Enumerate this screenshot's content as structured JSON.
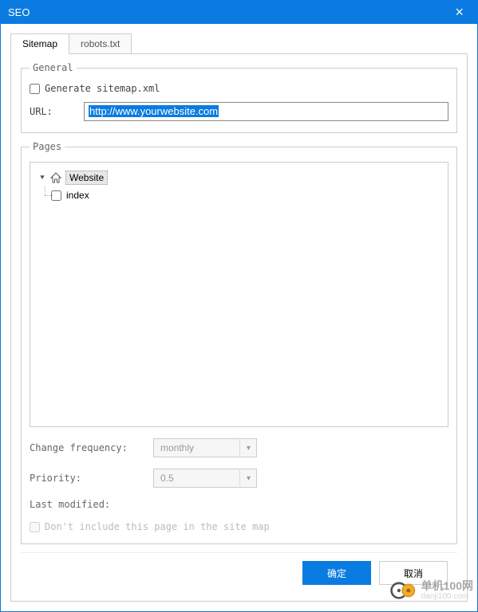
{
  "window": {
    "title": "SEO"
  },
  "tabs": {
    "sitemap": "Sitemap",
    "robots": "robots.txt"
  },
  "general": {
    "legend": "General",
    "generate_label": "Generate sitemap.xml",
    "generate_checked": false,
    "url_label": "URL:",
    "url_value": "http://www.yourwebsite.com"
  },
  "pages": {
    "legend": "Pages",
    "tree": {
      "root": {
        "label": "Website",
        "expanded": true
      },
      "children": [
        {
          "label": "index",
          "checked": false
        }
      ]
    },
    "change_freq_label": "Change frequency:",
    "change_freq_value": "monthly",
    "priority_label": "Priority:",
    "priority_value": "0.5",
    "last_modified_label": "Last modified:",
    "last_modified_value": "",
    "exclude_label": "Don't include this page in the site map",
    "exclude_checked": false
  },
  "buttons": {
    "ok": "确定",
    "cancel": "取消"
  },
  "watermark": {
    "brand": "单机100网",
    "domain": "danji100.com"
  }
}
